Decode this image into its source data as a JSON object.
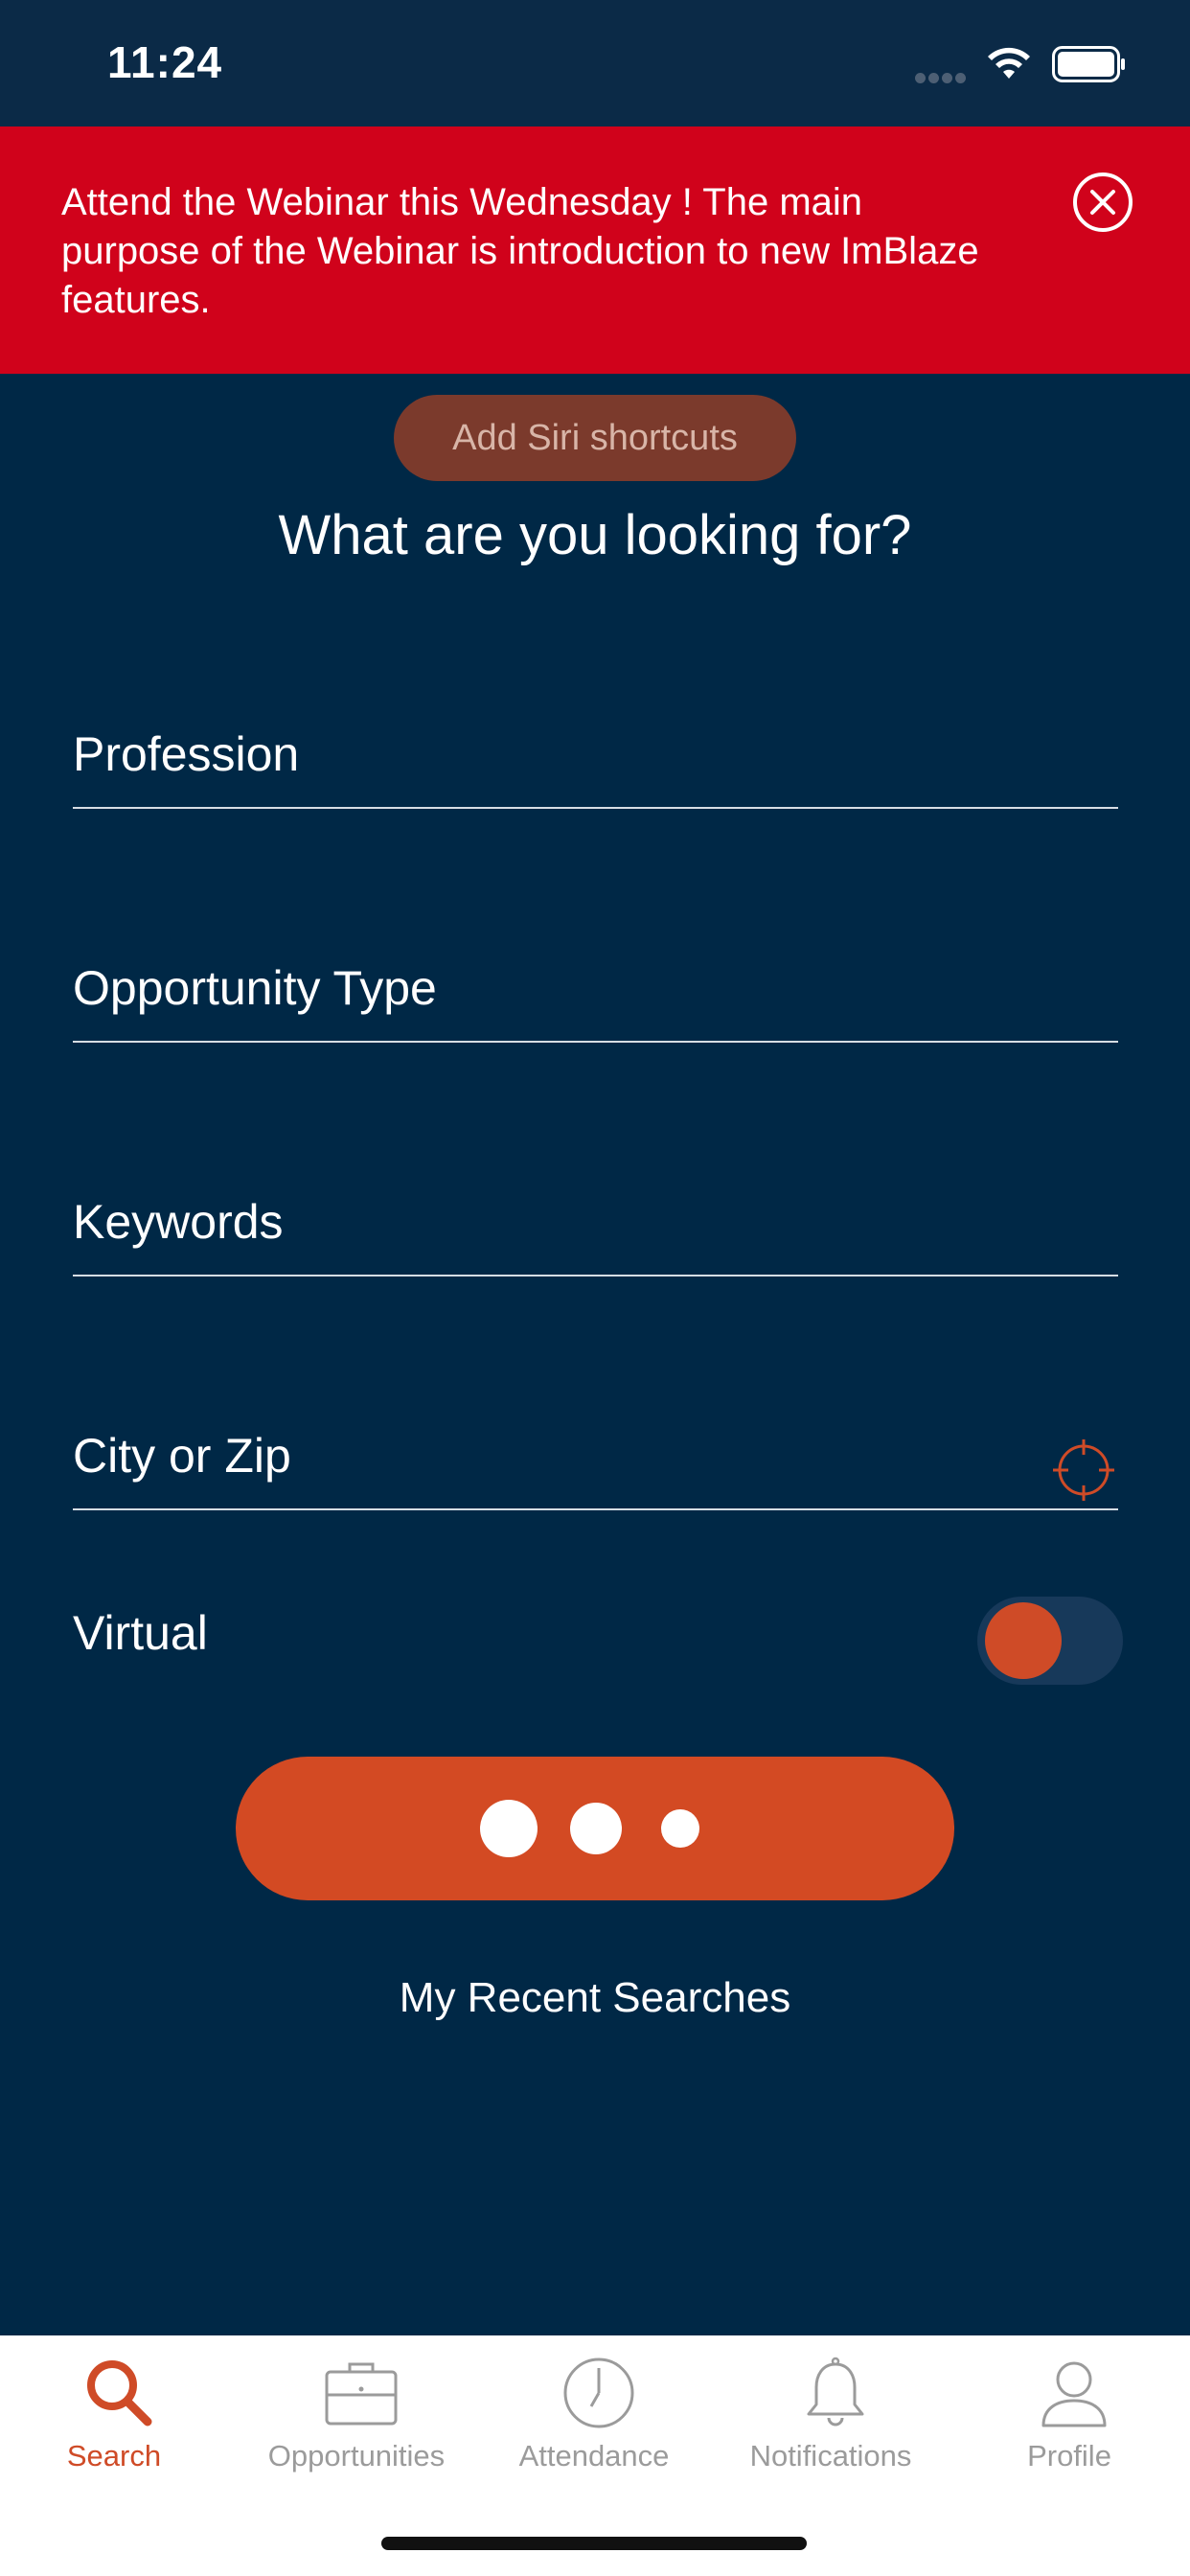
{
  "status_bar": {
    "time": "11:24"
  },
  "banner": {
    "message": "Attend the Webinar this Wednesday ! The main purpose of the Webinar is introduction to new ImBlaze features."
  },
  "siri": {
    "label": "Add Siri shortcuts"
  },
  "main": {
    "title": "What are you looking for?",
    "fields": {
      "profession": {
        "placeholder": "Profession",
        "value": ""
      },
      "opportunity_type": {
        "placeholder": "Opportunity Type",
        "value": ""
      },
      "keywords": {
        "placeholder": "Keywords",
        "value": ""
      },
      "city_zip": {
        "placeholder": "City or Zip",
        "value": ""
      }
    },
    "virtual": {
      "label": "Virtual"
    },
    "recent_searches": "My Recent Searches"
  },
  "tabs": [
    {
      "label": "Search",
      "icon": "search-icon",
      "active": true
    },
    {
      "label": "Opportunities",
      "icon": "briefcase-icon",
      "active": false
    },
    {
      "label": "Attendance",
      "icon": "clock-icon",
      "active": false
    },
    {
      "label": "Notifications",
      "icon": "bell-icon",
      "active": false
    },
    {
      "label": "Profile",
      "icon": "person-icon",
      "active": false
    }
  ],
  "colors": {
    "background": "#002846",
    "banner": "#d0021b",
    "accent": "#cf4b27",
    "tab_inactive": "#9b9b9b"
  }
}
